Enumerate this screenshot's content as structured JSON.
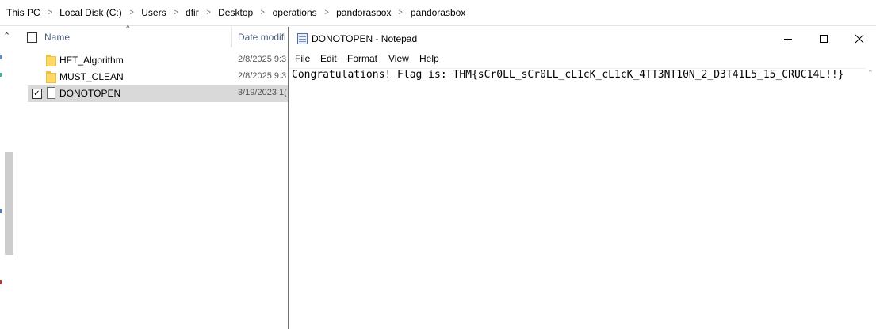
{
  "breadcrumb": [
    "This PC",
    "Local Disk (C:)",
    "Users",
    "dfir",
    "Desktop",
    "operations",
    "pandorasbox",
    "pandorasbox"
  ],
  "explorer": {
    "columns": {
      "name": "Name",
      "date": "Date modifi"
    },
    "rows": [
      {
        "name": "HFT_Algorithm",
        "date": "2/8/2025 9:3",
        "type": "folder",
        "selected": false
      },
      {
        "name": "MUST_CLEAN",
        "date": "2/8/2025 9:3",
        "type": "folder",
        "selected": false
      },
      {
        "name": "DONOTOPEN",
        "date": "3/19/2023 1(",
        "type": "file",
        "selected": true
      }
    ]
  },
  "notepad": {
    "title": "DONOTOPEN - Notepad",
    "menu": [
      "File",
      "Edit",
      "Format",
      "View",
      "Help"
    ],
    "content": "Congratulations! Flag is: THM{sCr0LL_sCr0LL_cL1cK_cL1cK_4TT3NT10N_2_D3T41L5_15_CRUC14L!!}"
  },
  "colors": {
    "selected_row": "#d9d9d9",
    "header_text": "#4c607a",
    "scrollbar": "#cdcdcd"
  },
  "icons": {
    "folder": "folder-icon",
    "file": "file-icon",
    "notepad": "notepad-icon",
    "minimize": "minimize-icon",
    "maximize": "maximize-icon",
    "close": "close-icon"
  }
}
